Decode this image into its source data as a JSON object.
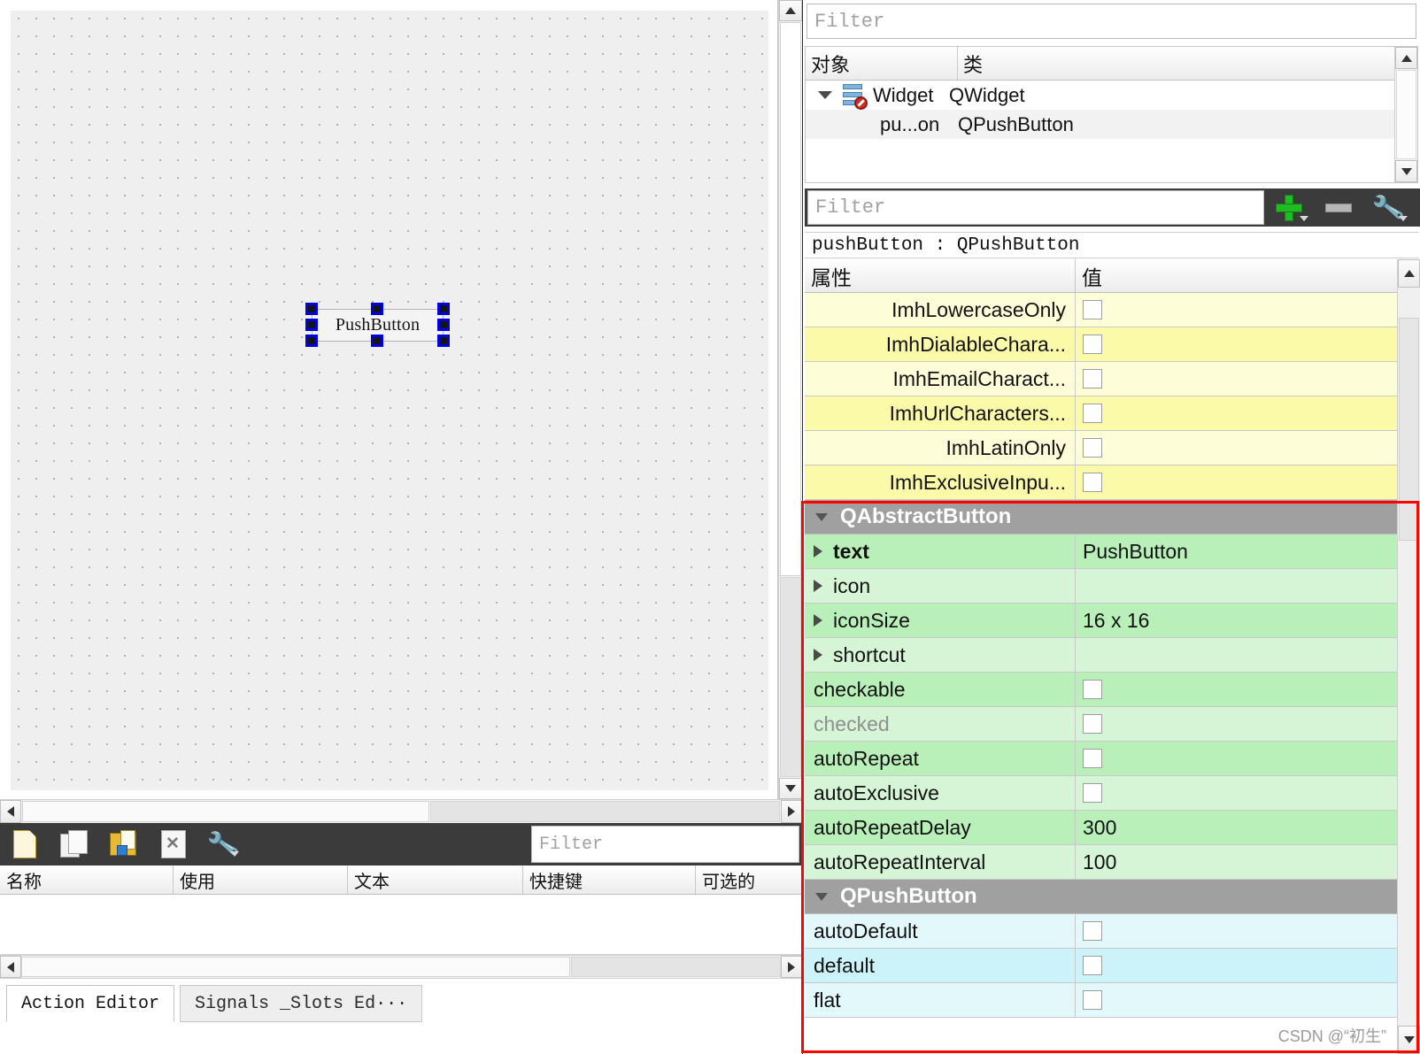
{
  "form_editor": {
    "widget": {
      "label": "PushButton"
    }
  },
  "action_editor": {
    "toolbar": {
      "new_icon": "new-document-icon",
      "copy_icon": "copy-document-icon",
      "save_icon": "save-document-icon",
      "delete_icon": "delete-document-icon",
      "configure_icon": "wrench-icon",
      "filter_placeholder": "Filter"
    },
    "columns": [
      "名称",
      "使用",
      "文本",
      "快捷键",
      "可选的"
    ],
    "rows": [],
    "tabs": [
      {
        "label": "Action Editor",
        "active": true
      },
      {
        "label": "Signals _Slots Ed···",
        "active": false
      }
    ]
  },
  "object_inspector": {
    "filter_placeholder": "Filter",
    "columns": [
      "对象",
      "类"
    ],
    "rows": [
      {
        "object": "Widget",
        "class": "QWidget",
        "icon": "widget-icon",
        "expanded": true
      },
      {
        "object": "pu...on",
        "class": "QPushButton",
        "selected": true
      }
    ]
  },
  "property_editor": {
    "filter_placeholder": "Filter",
    "add_label": "+",
    "remove_label": "−",
    "configure_icon": "wrench-icon",
    "object_line": "pushButton : QPushButton",
    "columns": [
      "属性",
      "值"
    ],
    "rows": [
      {
        "name": "ImhLowercaseOnly",
        "value": "",
        "kind": "checkbox",
        "checked": false,
        "color": "yellow",
        "expandable": false,
        "indent": "right"
      },
      {
        "name": "ImhDialableChara...",
        "value": "",
        "kind": "checkbox",
        "checked": false,
        "color": "yellow2",
        "expandable": false,
        "indent": "right"
      },
      {
        "name": "ImhEmailCharact...",
        "value": "",
        "kind": "checkbox",
        "checked": false,
        "color": "yellow",
        "expandable": false,
        "indent": "right"
      },
      {
        "name": "ImhUrlCharacters...",
        "value": "",
        "kind": "checkbox",
        "checked": false,
        "color": "yellow2",
        "expandable": false,
        "indent": "right"
      },
      {
        "name": "ImhLatinOnly",
        "value": "",
        "kind": "checkbox",
        "checked": false,
        "color": "yellow",
        "expandable": false,
        "indent": "right"
      },
      {
        "name": "ImhExclusiveInpu...",
        "value": "",
        "kind": "checkbox",
        "checked": false,
        "color": "yellow2",
        "expandable": false,
        "indent": "right"
      },
      {
        "name": "QAbstractButton",
        "kind": "group",
        "expanded": true
      },
      {
        "name": "text",
        "value": "PushButton",
        "kind": "text",
        "color": "green",
        "expandable": true,
        "bold": true
      },
      {
        "name": "icon",
        "value": "",
        "kind": "text",
        "color": "green2",
        "expandable": true
      },
      {
        "name": "iconSize",
        "value": "16 x 16",
        "kind": "text",
        "color": "green",
        "expandable": true
      },
      {
        "name": "shortcut",
        "value": "",
        "kind": "text",
        "color": "green2",
        "expandable": true
      },
      {
        "name": "checkable",
        "value": "",
        "kind": "checkbox",
        "checked": false,
        "color": "green",
        "expandable": false
      },
      {
        "name": "checked",
        "value": "",
        "kind": "checkbox",
        "checked": false,
        "color": "green2",
        "expandable": false,
        "disabled": true
      },
      {
        "name": "autoRepeat",
        "value": "",
        "kind": "checkbox",
        "checked": false,
        "color": "green",
        "expandable": false
      },
      {
        "name": "autoExclusive",
        "value": "",
        "kind": "checkbox",
        "checked": false,
        "color": "green2",
        "expandable": false
      },
      {
        "name": "autoRepeatDelay",
        "value": "300",
        "kind": "text",
        "color": "green",
        "expandable": false
      },
      {
        "name": "autoRepeatInterval",
        "value": "100",
        "kind": "text",
        "color": "green2",
        "expandable": false
      },
      {
        "name": "QPushButton",
        "kind": "group",
        "expanded": true
      },
      {
        "name": "autoDefault",
        "value": "",
        "kind": "checkbox",
        "checked": false,
        "color": "cyan",
        "expandable": false
      },
      {
        "name": "default",
        "value": "",
        "kind": "checkbox",
        "checked": false,
        "color": "cyan2",
        "expandable": false
      },
      {
        "name": "flat",
        "value": "",
        "kind": "checkbox",
        "checked": false,
        "color": "cyan",
        "expandable": false
      }
    ]
  },
  "annotation": {
    "highlight_color": "#fb0500"
  },
  "watermark": {
    "text": "CSDN @“初生”"
  }
}
